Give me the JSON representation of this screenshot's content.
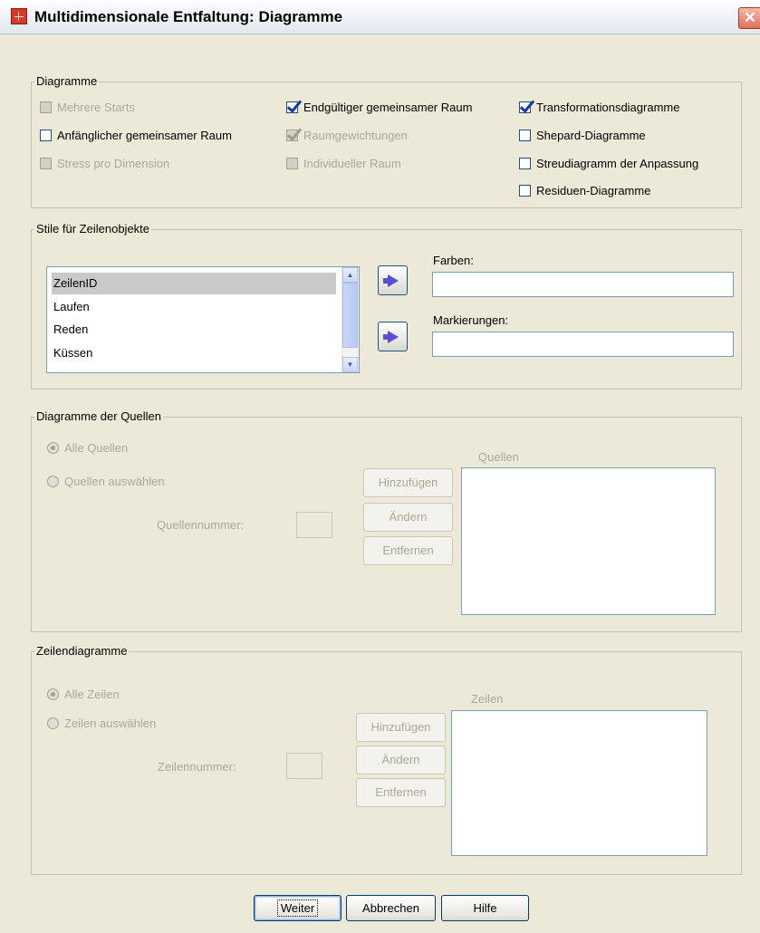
{
  "window": {
    "title": "Multidimensionale Entfaltung: Diagramme",
    "icon": "spss-table-icon",
    "close_label": "✕"
  },
  "diagramme": {
    "legend": "Diagramme",
    "checkboxes": [
      {
        "label": "Mehrere Starts",
        "checked": false,
        "enabled": false
      },
      {
        "label": "Anfänglicher gemeinsamer Raum",
        "checked": false,
        "enabled": true
      },
      {
        "label": "Stress pro Dimension",
        "checked": false,
        "enabled": false
      },
      {
        "label": "Endgültiger gemeinsamer Raum",
        "checked": true,
        "enabled": true
      },
      {
        "label": "Raumgewichtungen",
        "checked": true,
        "enabled": false
      },
      {
        "label": "Individueller Raum",
        "checked": false,
        "enabled": false
      },
      {
        "label": "Transformationsdiagramme",
        "checked": true,
        "enabled": true
      },
      {
        "label": "Shepard-Diagramme",
        "checked": false,
        "enabled": true
      },
      {
        "label": "Streudiagramm der Anpassung",
        "checked": false,
        "enabled": true
      },
      {
        "label": "Residuen-Diagramme",
        "checked": false,
        "enabled": true
      }
    ]
  },
  "stile": {
    "legend": "Stile für Zeilenobjekte",
    "list_items": [
      "ZeilenID",
      "Laufen",
      "Reden",
      "Küssen"
    ],
    "selected_item": "ZeilenID",
    "farben_label": "Farben:",
    "farben_value": "",
    "markierungen_label": "Markierungen:",
    "markierungen_value": ""
  },
  "quellen": {
    "legend": "Diagramme der Quellen",
    "radio_all": "Alle Quellen",
    "radio_select": "Quellen auswählen",
    "selected_radio": "Alle Quellen",
    "number_label": "Quellennummer:",
    "number_value": "",
    "list_label": "Quellen",
    "btn_add": "Hinzufügen",
    "btn_change": "Ändern",
    "btn_remove": "Entfernen"
  },
  "zeilen": {
    "legend": "Zeilendiagramme",
    "radio_all": "Alle Zeilen",
    "radio_select": "Zeilen auswählen",
    "selected_radio": "Alle Zeilen",
    "number_label": "Zeilennummer:",
    "number_value": "",
    "list_label": "Zeilen",
    "btn_add": "Hinzufügen",
    "btn_change": "Ändern",
    "btn_remove": "Entfernen"
  },
  "footer": {
    "weiter": "Weiter",
    "abbrechen": "Abbrechen",
    "hilfe": "Hilfe"
  },
  "colors": {
    "dialog_bg": "#ece9d8",
    "disabled_text": "#aca899",
    "check_mark": "#1a3d9c",
    "arrow_button": "#5a4fd1"
  }
}
